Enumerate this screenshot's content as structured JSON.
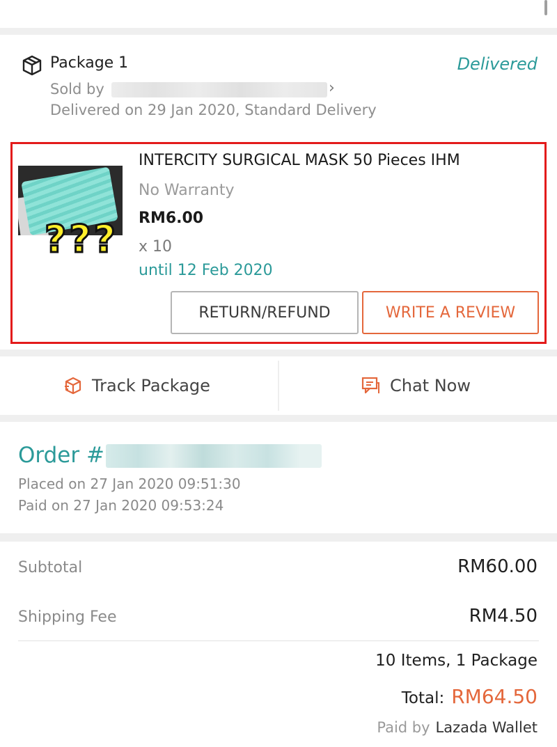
{
  "package": {
    "title": "Package 1",
    "status": "Delivered",
    "sold_by_label": "Sold by",
    "delivered_info": "Delivered on 29 Jan 2020, Standard Delivery"
  },
  "product": {
    "name": "INTERCITY SURGICAL MASK 50 Pieces IHM",
    "warranty": "No Warranty",
    "price": "RM6.00",
    "quantity": "x 10",
    "until": "until  12 Feb 2020",
    "overlay": "???",
    "return_button": "RETURN/REFUND",
    "review_button": "WRITE A REVIEW"
  },
  "actions": {
    "track": "Track Package",
    "chat": "Chat Now"
  },
  "order": {
    "label": "Order #",
    "placed": "Placed on 27 Jan 2020  09:51:30",
    "paid": "Paid on 27 Jan 2020  09:53:24"
  },
  "totals": {
    "subtotal_label": "Subtotal",
    "subtotal_value": "RM60.00",
    "shipping_label": "Shipping Fee",
    "shipping_value": "RM4.50",
    "items_count": "10 Items, 1 Package",
    "total_label": "Total:",
    "total_value": "RM64.50",
    "paid_by_label": "Paid by",
    "paid_by_value": "Lazada Wallet"
  },
  "colors": {
    "teal": "#2b9a99",
    "orange": "#e4673b",
    "highlight": "#e31b1b"
  },
  "icons": [
    "package-icon",
    "chevron-right-icon",
    "track-package-icon",
    "chat-icon"
  ]
}
